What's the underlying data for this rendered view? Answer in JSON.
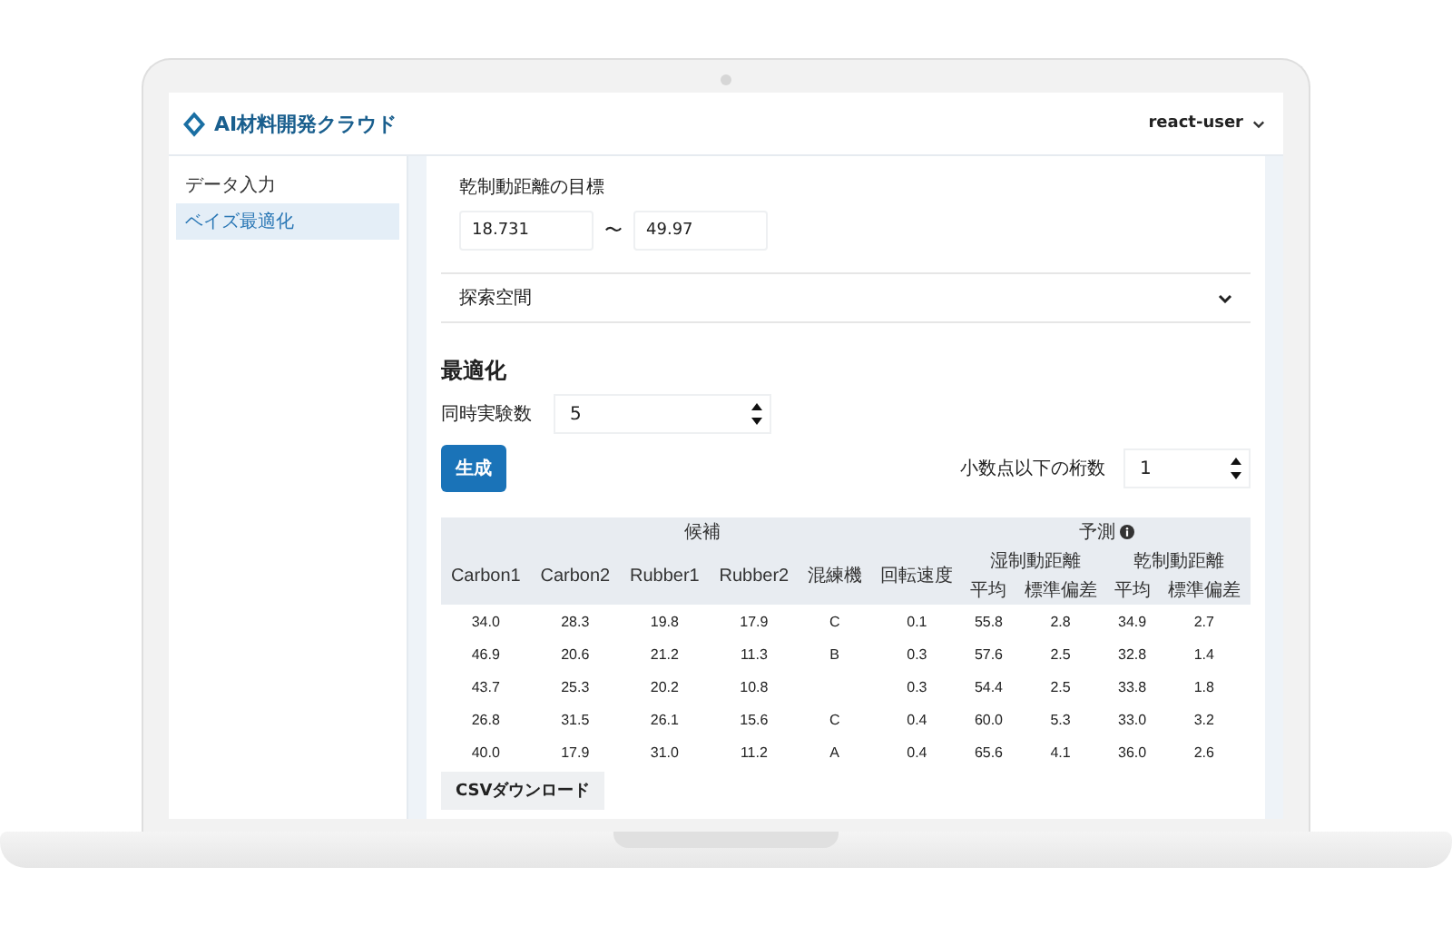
{
  "app": {
    "title": "AI材料開発クラウド",
    "user": "react-user"
  },
  "sidebar": {
    "items": [
      {
        "label": "データ入力",
        "selected": false
      },
      {
        "label": "ベイズ最適化",
        "selected": true
      }
    ]
  },
  "target": {
    "label": "乾制動距離の目標",
    "min": "18.731",
    "separator": "〜",
    "max": "49.97"
  },
  "accordion": {
    "label": "探索空間",
    "expanded": false
  },
  "optimize": {
    "title": "最適化",
    "count_label": "同時実験数",
    "count": "5",
    "generate_button": "生成",
    "digits_label": "小数点以下の桁数",
    "digits": "1"
  },
  "table": {
    "groups": [
      {
        "label": "候補",
        "info": false,
        "columns": [
          {
            "label": "Carbon1"
          },
          {
            "label": "Carbon2"
          },
          {
            "label": "Rubber1"
          },
          {
            "label": "Rubber2"
          },
          {
            "label": "混練機"
          },
          {
            "label": "回転速度"
          }
        ]
      },
      {
        "label": "予測",
        "info": true,
        "columns": [
          {
            "label": "湿制動距離",
            "sub": [
              "平均",
              "標準偏差"
            ]
          },
          {
            "label": "乾制動距離",
            "sub": [
              "平均",
              "標準偏差"
            ]
          }
        ]
      }
    ],
    "rows": [
      [
        "34.0",
        "28.3",
        "19.8",
        "17.9",
        "C",
        "0.1",
        "55.8",
        "2.8",
        "34.9",
        "2.7"
      ],
      [
        "46.9",
        "20.6",
        "21.2",
        "11.3",
        "B",
        "0.3",
        "57.6",
        "2.5",
        "32.8",
        "1.4"
      ],
      [
        "43.7",
        "25.3",
        "20.2",
        "10.8",
        "",
        "0.3",
        "54.4",
        "2.5",
        "33.8",
        "1.8"
      ],
      [
        "26.8",
        "31.5",
        "26.1",
        "15.6",
        "C",
        "0.4",
        "60.0",
        "5.3",
        "33.0",
        "3.2"
      ],
      [
        "40.0",
        "17.9",
        "31.0",
        "11.2",
        "A",
        "0.4",
        "65.6",
        "4.1",
        "36.0",
        "2.6"
      ]
    ]
  },
  "csv_button": "CSVダウンロード"
}
